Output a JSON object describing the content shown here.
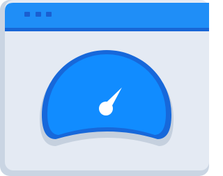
{
  "icon": "speedometer-browser-icon",
  "colors": {
    "frame_shadow": "#cad5e3",
    "window_body": "#e4eaf3",
    "title_bar": "#1f8ef7",
    "title_bar_shadow": "#1766d6",
    "window_dots": "#1a5fd1",
    "gauge_shadow": "#c5d0de",
    "gauge_rim": "#1768da",
    "gauge_face": "#118cff",
    "gauge_base": "#e4eaf3",
    "needle": "#ffffff"
  },
  "gauge": {
    "needle_angle_deg": 53
  }
}
